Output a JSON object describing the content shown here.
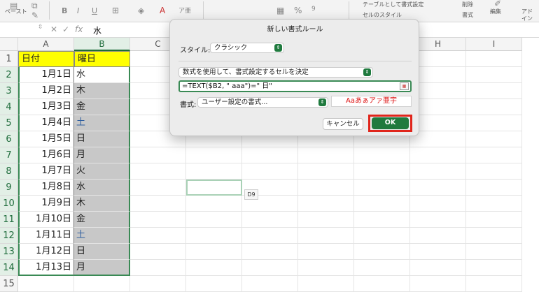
{
  "ribbon": {
    "paste_label": "ペースト",
    "bold": "B",
    "italic": "I",
    "underline": "U",
    "percent": "%",
    "table_format_label": "テーブルとして書式設定",
    "cell_style_label": "セルのスタイル",
    "delete_label": "削除",
    "format_label": "書式",
    "edit_label": "編集",
    "addin_label_1": "アド",
    "addin_label_2": "イン"
  },
  "formula_bar": {
    "fx": "fx",
    "value": "水"
  },
  "columns": [
    "A",
    "B",
    "C",
    "D",
    "E",
    "F",
    "G",
    "H",
    "I"
  ],
  "rows": [
    "1",
    "2",
    "3",
    "4",
    "5",
    "6",
    "7",
    "8",
    "9",
    "10",
    "11",
    "12",
    "13",
    "14",
    "15"
  ],
  "sheet": {
    "header_a": "日付",
    "header_b": "曜日",
    "dates": [
      "1月1日",
      "1月2日",
      "1月3日",
      "1月4日",
      "1月5日",
      "1月6日",
      "1月7日",
      "1月8日",
      "1月9日",
      "1月10日",
      "1月11日",
      "1月12日",
      "1月13日"
    ],
    "weekdays": [
      "水",
      "木",
      "金",
      "土",
      "日",
      "月",
      "火",
      "水",
      "木",
      "金",
      "土",
      "日",
      "月"
    ],
    "header_color": "#ffff00",
    "saturday_color": "#2f5f9f",
    "gray_fill": "#c8c8c8"
  },
  "tooltip": "D9",
  "dialog": {
    "title": "新しい書式ルール",
    "style_label": "スタイル:",
    "style_value": "クラシック",
    "rule_type": "数式を使用して、書式設定するセルを決定",
    "formula": "=TEXT($B2, \" aaa\")=\" 日\"",
    "format_label": "書式:",
    "format_value": "ユーザー設定の書式...",
    "preview": "Aaあぁアァ亜宇",
    "cancel": "キャンセル",
    "ok": "OK",
    "accent": "#1f7a3e",
    "highlight": "#e0251b"
  }
}
